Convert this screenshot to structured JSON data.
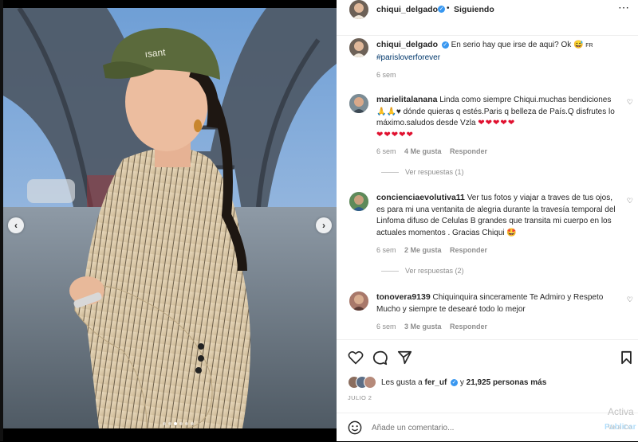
{
  "post": {
    "author": "chiqui_delgado",
    "follow_state": "Siguiendo",
    "caption": "En serio hay que irse de aqui? Ok 😅",
    "caption_flag": "FR",
    "hashtag": "#parisloverforever",
    "time": "6 sem"
  },
  "comments": [
    {
      "user": "marielitalanana",
      "text": "Linda como siempre Chiqui.muchas bendiciones 🙏🙏♥ dónde quieras q estés.Paris q belleza de País.Q disfrutes lo máximo.saludos desde Vzla",
      "hearts_inline": "❤❤❤❤❤",
      "hearts_line": "❤❤❤❤❤",
      "time": "6 sem",
      "likes": "4 Me gusta",
      "reply": "Responder",
      "view_replies": "Ver respuestas (1)"
    },
    {
      "user": "concienciaevolutiva11",
      "text": "Ver tus fotos y viajar a traves de tus ojos, es para mi una ventanita de alegria durante la travesía temporal del Linfoma difuso de Celulas B grandes que transita mi cuerpo en los actuales momentos . Gracias Chiqui 🤩",
      "time": "6 sem",
      "likes": "2 Me gusta",
      "reply": "Responder",
      "view_replies": "Ver respuestas (2)"
    },
    {
      "user": "tonovera9139",
      "text": "Chiquinquira sinceramente Te Admiro y Respeto Mucho y siempre te desearé todo lo mejor",
      "time": "6 sem",
      "likes": "3 Me gusta",
      "reply": "Responder"
    }
  ],
  "likes": {
    "prefix": "Les gusta a",
    "user": "fer_uf",
    "joiner": "y",
    "count": "21,925 personas más"
  },
  "date": "JULIO 2",
  "add_comment": {
    "placeholder": "Añade un comentario...",
    "publish": "Publicar"
  },
  "watermark": {
    "line1": "Activa",
    "line2": "Ve a Co"
  },
  "icons": [
    "more-icon",
    "heart-icon",
    "comment-icon",
    "share-icon",
    "save-icon",
    "emoji-icon",
    "chevron-left-icon",
    "chevron-right-icon"
  ],
  "colors": {
    "accent": "#3897f0",
    "hashtag": "#00376b",
    "meta": "#8e8e8e",
    "text": "#262626"
  },
  "media": {
    "slide_count": 6,
    "active_slide": 3
  }
}
